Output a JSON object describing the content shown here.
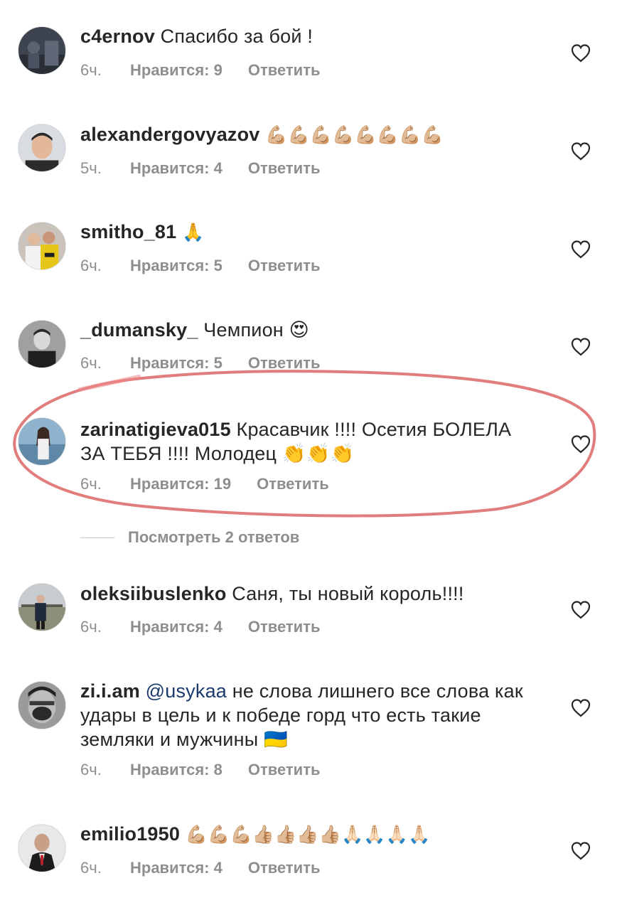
{
  "comments": [
    {
      "username": "c4ernov",
      "text": "Спасибо за бой !",
      "time": "6ч.",
      "likes": "Нравится: 9",
      "reply": "Ответить"
    },
    {
      "username": "alexandergovyazov",
      "text": "💪🏼💪🏼💪🏼💪🏼💪🏼💪🏼💪🏼💪🏼",
      "time": "5ч.",
      "likes": "Нравится: 4",
      "reply": "Ответить"
    },
    {
      "username": "smitho_81",
      "text": "🙏",
      "time": "6ч.",
      "likes": "Нравится: 5",
      "reply": "Ответить"
    },
    {
      "username": "_dumansky_",
      "text": "Чемпион 😍",
      "time": "6ч.",
      "likes": "Нравится: 5",
      "reply": "Ответить"
    },
    {
      "username": "zarinatigieva015",
      "text": "Красавчик !!!! Осетия БОЛЕЛА ЗА ТЕБЯ !!!! Молодец 👏👏👏",
      "time": "6ч.",
      "likes": "Нравится: 19",
      "reply": "Ответить"
    },
    {
      "username": "oleksiibuslenko",
      "text": "Саня, ты новый король!!!!",
      "time": "6ч.",
      "likes": "Нравится: 4",
      "reply": "Ответить"
    },
    {
      "username": "zi.i.am",
      "mention": "@usykaa",
      "text": "не слова лишнего все слова как удары в цель и к победе горд что есть такие земляки и мужчины 🇺🇦",
      "time": "6ч.",
      "likes": "Нравится: 8",
      "reply": "Ответить"
    },
    {
      "username": "emilio1950",
      "text": "💪🏼💪🏼💪🏼👍🏼👍🏼👍🏼👍🏼🙏🏻🙏🏻🙏🏻🙏🏻",
      "time": "6ч.",
      "likes": "Нравится: 4",
      "reply": "Ответить"
    }
  ],
  "view_replies": "Посмотреть 2 ответов",
  "icons": {
    "like": "heart-outline-icon"
  },
  "colors": {
    "text": "#262626",
    "meta": "#8e8e8e",
    "mention": "#1b3a6e",
    "highlight": "#e05555"
  }
}
